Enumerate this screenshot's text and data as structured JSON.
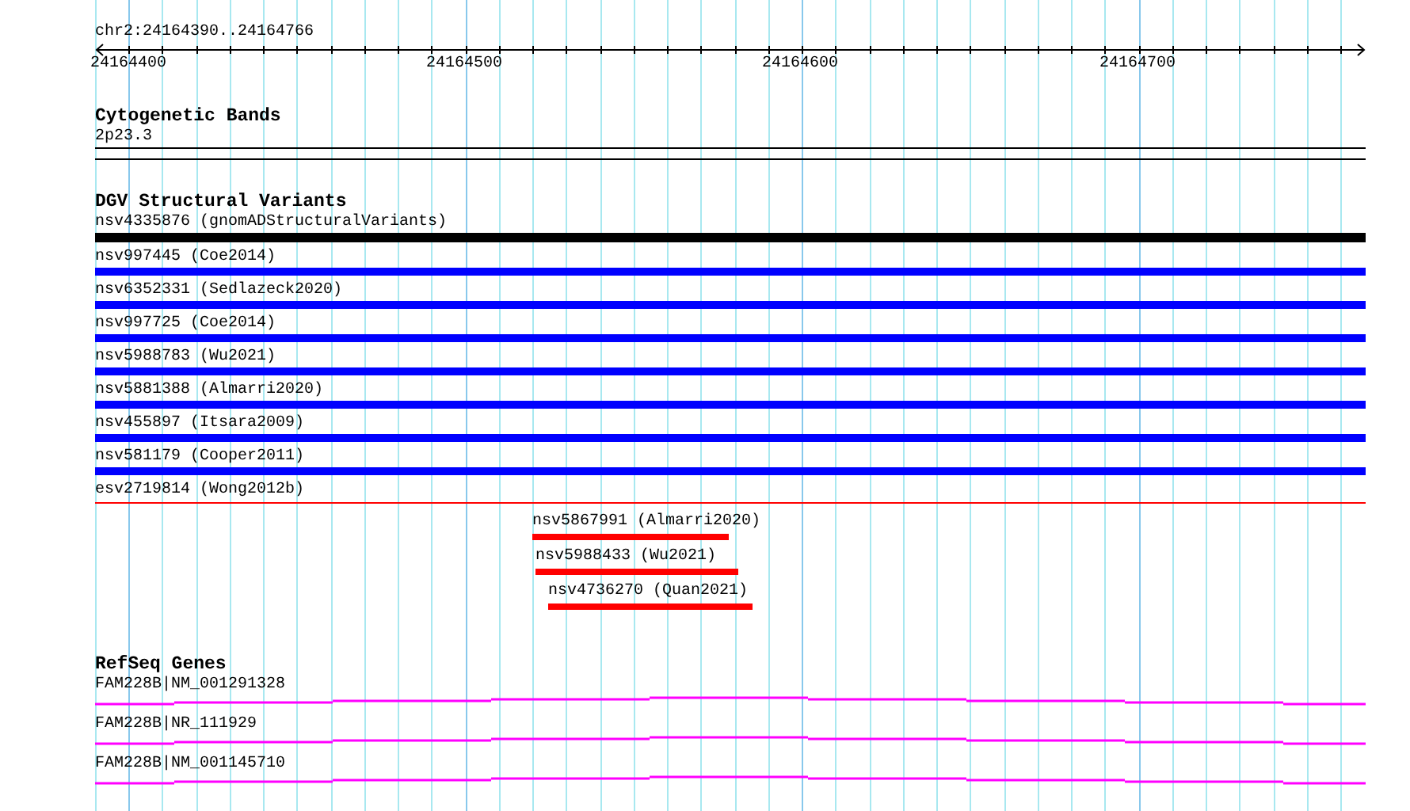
{
  "location": "chr2:24164390..24164766",
  "ruler": {
    "ticks": [
      "24164400",
      "24164500",
      "24164600",
      "24164700"
    ]
  },
  "tracks": [
    {
      "kind": "bands",
      "title": "Cytogenetic Bands",
      "features": [
        {
          "label": "2p23.3",
          "kind": "outline",
          "color": "#000000"
        }
      ]
    },
    {
      "kind": "variants",
      "title": "DGV Structural Variants",
      "features": [
        {
          "label": "nsv4335876 (gnomADStructuralVariants)",
          "kind": "full",
          "color": "#000000"
        },
        {
          "label": "nsv997445 (Coe2014)",
          "kind": "full",
          "color": "#0000ff"
        },
        {
          "label": "nsv6352331 (Sedlazeck2020)",
          "kind": "full",
          "color": "#0000ff"
        },
        {
          "label": "nsv997725 (Coe2014)",
          "kind": "full",
          "color": "#0000ff"
        },
        {
          "label": "nsv5988783 (Wu2021)",
          "kind": "full",
          "color": "#0000ff"
        },
        {
          "label": "nsv5881388 (Almarri2020)",
          "kind": "full",
          "color": "#0000ff"
        },
        {
          "label": "nsv455897 (Itsara2009)",
          "kind": "full",
          "color": "#0000ff"
        },
        {
          "label": "nsv581179 (Cooper2011)",
          "kind": "full",
          "color": "#0000ff"
        },
        {
          "label": "esv2719814 (Wong2012b)",
          "kind": "line",
          "color": "#ff0000"
        },
        {
          "label": "nsv5867991 (Almarri2020)",
          "kind": "partial",
          "color": "#ff0000"
        },
        {
          "label": "nsv5988433 (Wu2021)",
          "kind": "partial",
          "color": "#ff0000"
        },
        {
          "label": "nsv4736270 (Quan2021)",
          "kind": "partial",
          "color": "#ff0000"
        }
      ]
    },
    {
      "kind": "genes",
      "title": "RefSeq Genes",
      "features": [
        {
          "label": "FAM228B|NM_001291328",
          "kind": "gene",
          "color": "#ff00ff"
        },
        {
          "label": "FAM228B|NR_111929",
          "kind": "gene",
          "color": "#ff00ff"
        },
        {
          "label": "FAM228B|NM_001145710",
          "kind": "gene",
          "color": "#ff00ff"
        }
      ]
    }
  ]
}
